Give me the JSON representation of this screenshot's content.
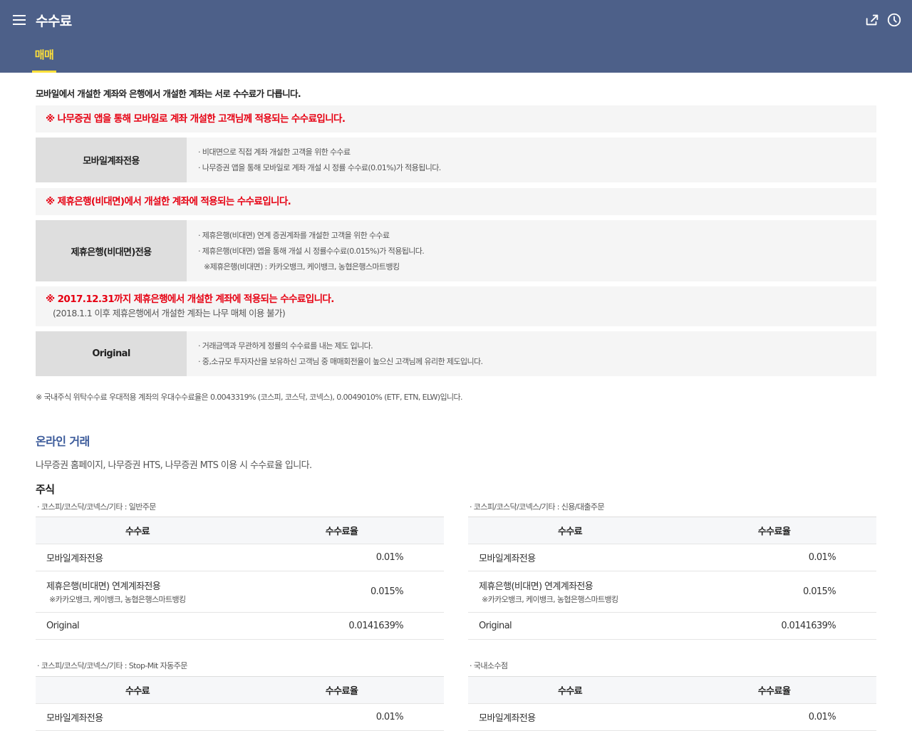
{
  "header": {
    "title": "수수료",
    "menu_icon": "hamburger-icon",
    "share_icon": "share-icon",
    "history_icon": "clock-icon",
    "tab": "매매"
  },
  "intro": "모바일에서 개설한 계좌와 은행에서 개설한 계좌는 서로 수수료가 다릅니다.",
  "notices": [
    {
      "text": "※ 나무증권 앱을 통해 모바일로 계좌 개설한 고객님께 적용되는 수수료입니다."
    },
    {
      "text": "※ 제휴은행(비대면)에서 개설한 계좌에 적용되는 수수료입니다."
    },
    {
      "text": "※ 2017.12.31까지 제휴은행에서 개설한 계좌에 적용되는 수수료입니다.",
      "sub": "(2018.1.1 이후 제휴은행에서 개설한 계좌는 나무 매체 이용 불가)"
    }
  ],
  "fee_types": [
    {
      "label": "모바일계좌전용",
      "bullets": [
        "비대면으로 직접 계좌 개설한 고객을 위한 수수료",
        "나무증권 앱을 통해 모바일로 계좌 개설 시 정률 수수료(0.01%)가 적용됩니다."
      ],
      "note": ""
    },
    {
      "label": "제휴은행(비대면)전용",
      "bullets": [
        "제휴은행(비대면) 연계 증권계좌를 개설한 고객을 위한 수수료",
        "제휴은행(비대면) 앱을 통해 개설 시 정률수수료(0.015%)가 적용됩니다."
      ],
      "note": "※제휴은행(비대면) : 카카오뱅크, 케이뱅크, 농협은행스마트뱅킹"
    },
    {
      "label": "Original",
      "bullets": [
        "거래금액과 무관하게 정률의 수수료를 내는 제도 입니다.",
        "중,소규모 투자자산을 보유하신 고객님 중 매매회전율이 높으신 고객님께 유리한 제도입니다."
      ],
      "note": ""
    }
  ],
  "footnote": "※   국내주식 위탁수수료 우대적용 계좌의 우대수수료율은 0.0043319% (코스피, 코스닥, 코넥스), 0.0049010% (ETF, ETN, ELW)입니다.",
  "online": {
    "title": "온라인 거래",
    "desc": "나무증권 홈페이지, 나무증권 HTS, 나무증권 MTS 이용 시 수수료율 입니다.",
    "subtitle": "주식"
  },
  "tables": [
    {
      "caption": "코스피/코스닥/코넥스/기타 : 일반주문",
      "headers": [
        "수수료",
        "수수료율"
      ],
      "rows": [
        {
          "name": "모바일계좌전용",
          "note": "",
          "rate": "0.01%"
        },
        {
          "name": "제휴은행(비대면) 연계계좌전용",
          "note": "※카카오뱅크, 케이뱅크, 농협은행스마트뱅킹",
          "rate": "0.015%"
        },
        {
          "name": "Original",
          "note": "",
          "rate": "0.0141639%"
        }
      ]
    },
    {
      "caption": "코스피/코스닥/코넥스/기타 : 신용/대출주문",
      "headers": [
        "수수료",
        "수수료율"
      ],
      "rows": [
        {
          "name": "모바일계좌전용",
          "note": "",
          "rate": "0.01%"
        },
        {
          "name": "제휴은행(비대면) 연계계좌전용",
          "note": "※카카오뱅크, 케이뱅크, 농협은행스마트뱅킹",
          "rate": "0.015%"
        },
        {
          "name": "Original",
          "note": "",
          "rate": "0.0141639%"
        }
      ]
    },
    {
      "caption": "코스피/코스닥/코넥스/기타 : Stop-Mit 자동주문",
      "headers": [
        "수수료",
        "수수료율"
      ],
      "rows": [
        {
          "name": "모바일계좌전용",
          "note": "",
          "rate": "0.01%"
        }
      ]
    },
    {
      "caption": "국내소수점",
      "headers": [
        "수수료",
        "수수료율"
      ],
      "rows": [
        {
          "name": "모바일계좌전용",
          "note": "",
          "rate": "0.01%"
        }
      ]
    }
  ]
}
